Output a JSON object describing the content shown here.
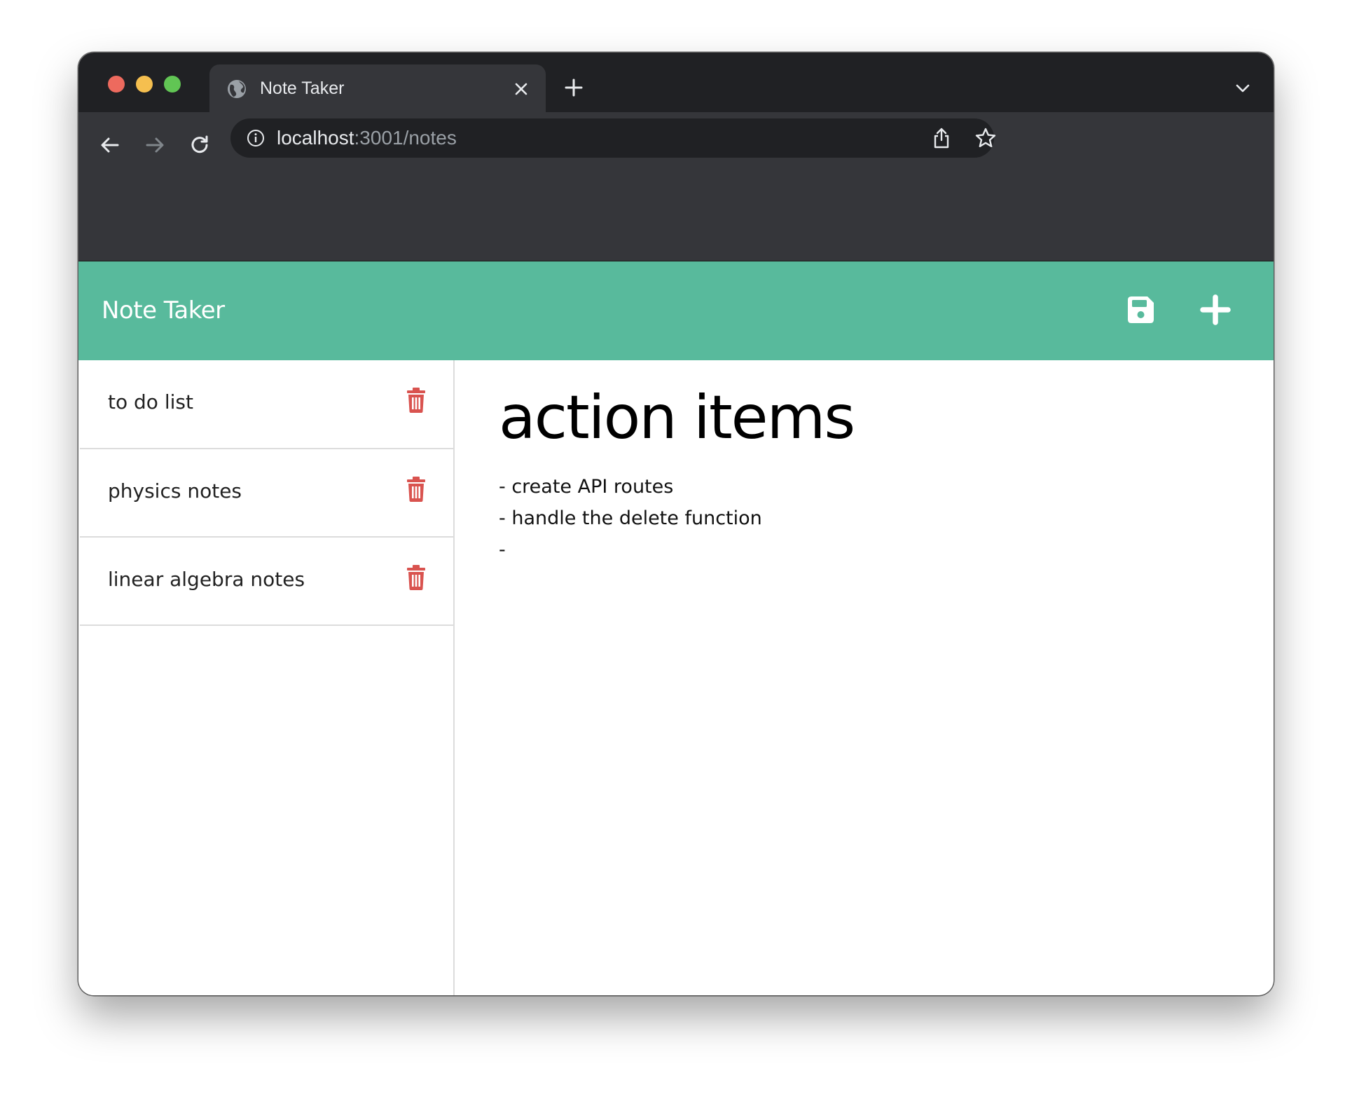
{
  "browser": {
    "tab_title": "Note Taker",
    "url_host": "localhost",
    "url_path": ":3001/notes"
  },
  "app": {
    "title": "Note Taker",
    "header_color": "#58ba9c",
    "delete_icon_color": "#d9534f"
  },
  "notes": [
    {
      "title": "to do list"
    },
    {
      "title": "physics notes"
    },
    {
      "title": "linear algebra notes"
    }
  ],
  "active_note": {
    "title": "action items",
    "lines": [
      "- create API routes",
      "- handle the delete function",
      "-"
    ]
  }
}
